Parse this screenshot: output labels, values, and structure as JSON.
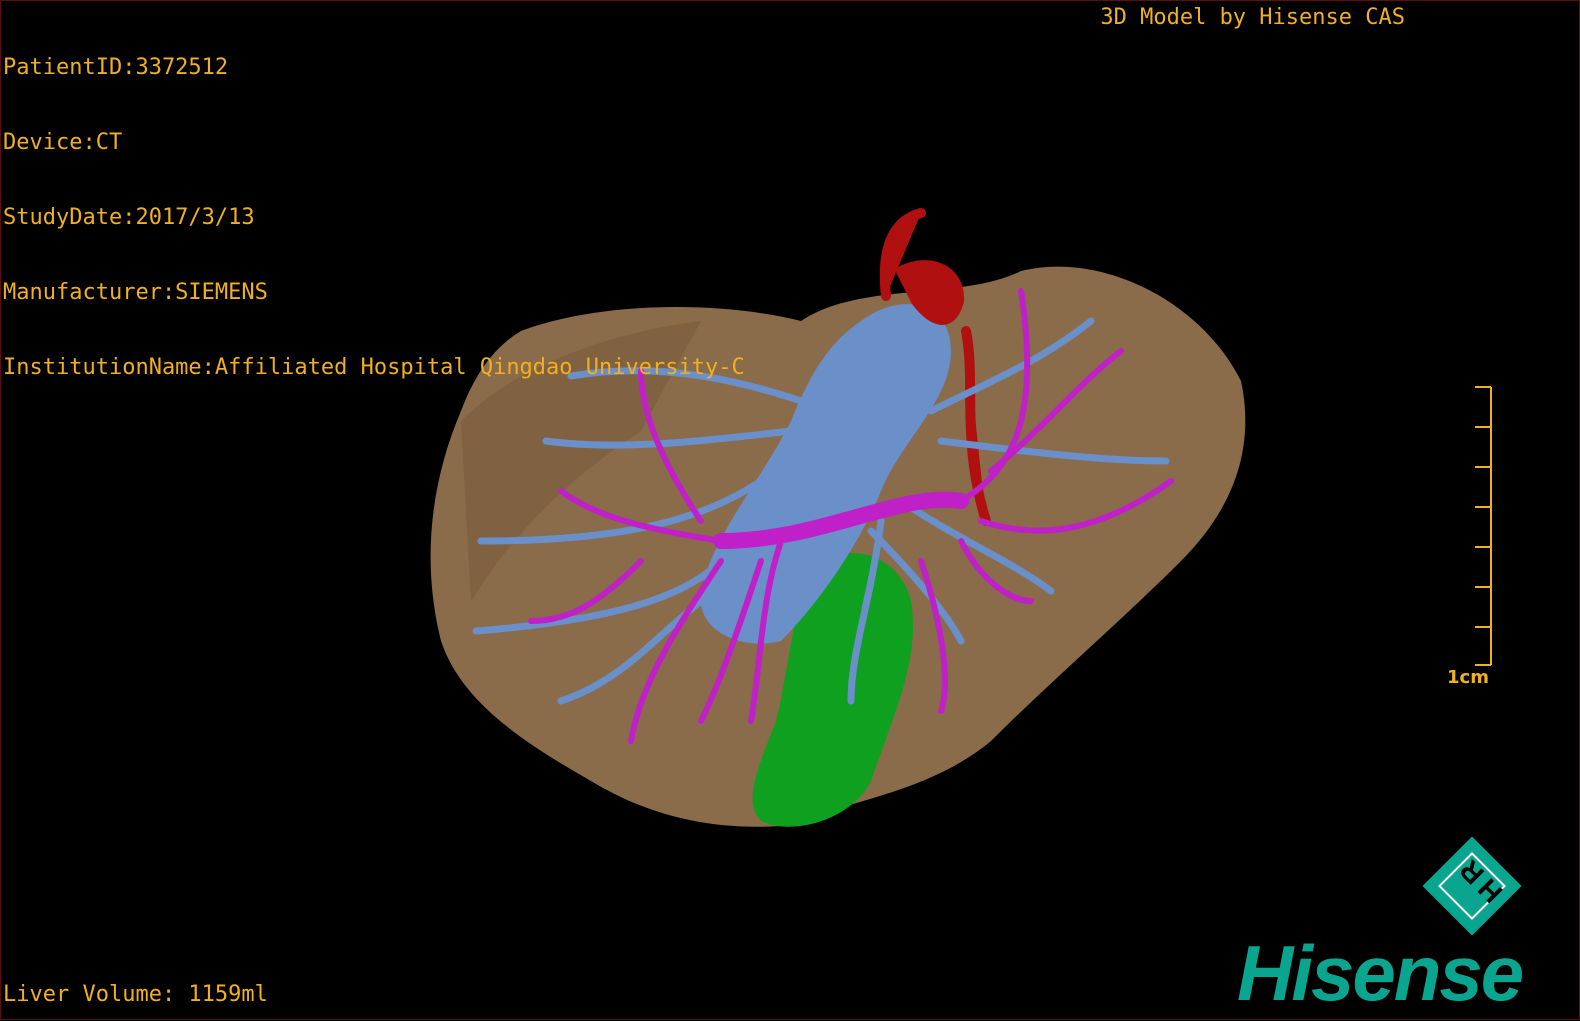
{
  "patient_info": {
    "patient_id": "PatientID:3372512",
    "device": "Device:CT",
    "study_date": "StudyDate:2017/3/13",
    "manufacturer": "Manufacturer:SIEMENS",
    "institution": "InstitutionName:Affiliated Hospital Qingdao University-C"
  },
  "model_label": "3D Model by Hisense CAS",
  "liver_volume": "Liver Volume: 1159ml",
  "scale_bar": {
    "label": "1cm",
    "divisions": 7
  },
  "logo": {
    "badge_text": "HR",
    "brand": "Hisense",
    "color": "#0aa58f"
  },
  "colors": {
    "text": "#f0b020",
    "liver": "#8a6b4a",
    "hepatic_vein": "#6b8fc9",
    "portal_vein": "#c020c8",
    "artery": "#b01010",
    "gallbladder": "#10a020"
  }
}
